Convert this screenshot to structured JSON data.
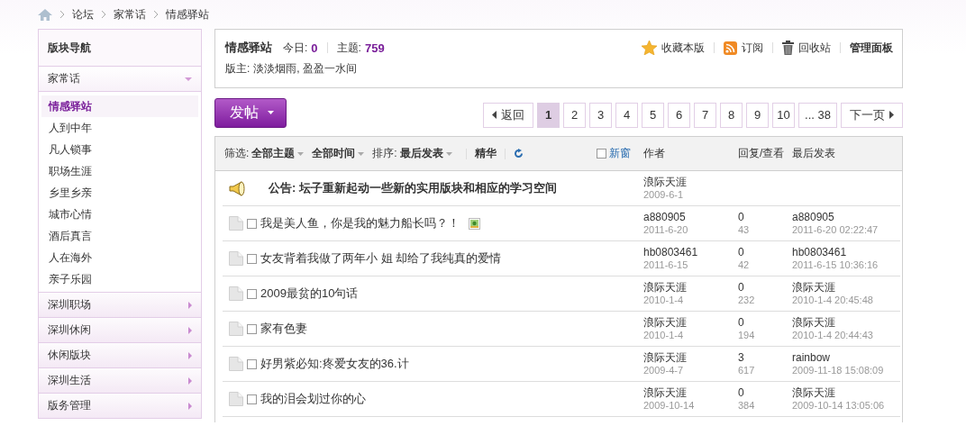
{
  "breadcrumb": [
    "论坛",
    "家常话",
    "情感驿站"
  ],
  "sidebar": {
    "title": "版块导航",
    "groups": [
      {
        "label": "家常话",
        "expanded": true,
        "children": [
          {
            "label": "情感驿站",
            "selected": true
          },
          {
            "label": "人到中年",
            "selected": false
          },
          {
            "label": "凡人锁事",
            "selected": false
          },
          {
            "label": "职场生涯",
            "selected": false
          },
          {
            "label": "乡里乡亲",
            "selected": false
          },
          {
            "label": "城市心情",
            "selected": false
          },
          {
            "label": "酒后真言",
            "selected": false
          },
          {
            "label": "人在海外",
            "selected": false
          },
          {
            "label": "亲子乐园",
            "selected": false
          }
        ]
      },
      {
        "label": "深圳职场",
        "expanded": false
      },
      {
        "label": "深圳休闲",
        "expanded": false
      },
      {
        "label": "休闲版块",
        "expanded": false
      },
      {
        "label": "深圳生活",
        "expanded": false
      },
      {
        "label": "版务管理",
        "expanded": false
      }
    ]
  },
  "forum": {
    "name": "情感驿站",
    "today_label": "今日:",
    "today": "0",
    "topics_label": "主题:",
    "topics": "759",
    "moderators_label": "版主:",
    "moderators": "淡淡烟雨, 盈盈一水间",
    "actions": [
      {
        "kind": "star",
        "label": "收藏本版"
      },
      {
        "kind": "rss",
        "label": "订阅"
      },
      {
        "kind": "trash",
        "label": "回收站"
      },
      {
        "kind": "admin",
        "label": "管理面板"
      }
    ]
  },
  "post_button": "发帖",
  "pagination": {
    "prev": "返回",
    "pages": [
      {
        "label": "1",
        "selected": true
      },
      {
        "label": "2",
        "selected": false
      },
      {
        "label": "3",
        "selected": false
      },
      {
        "label": "4",
        "selected": false
      },
      {
        "label": "5",
        "selected": false
      },
      {
        "label": "6",
        "selected": false
      },
      {
        "label": "7",
        "selected": false
      },
      {
        "label": "8",
        "selected": false
      },
      {
        "label": "9",
        "selected": false
      },
      {
        "label": "10",
        "selected": false
      },
      {
        "label": "... 38",
        "selected": false
      }
    ],
    "next": "下一页"
  },
  "filters": {
    "filter_label": "筛选:",
    "topic": "全部主题",
    "time": "全部时间",
    "sort_label": "排序:",
    "sort": "最后发表",
    "digest": "精华",
    "new_window": {
      "label": "新窗",
      "checked": false
    }
  },
  "columns": {
    "author": "作者",
    "stats": "回复/查看",
    "last": "最后发表"
  },
  "rows": [
    {
      "kind": "announcement",
      "title": "公告: 坛子重新起动一些新的实用版块和相应的学习空间",
      "author": "浪际天涯",
      "date": "2009-6-1"
    },
    {
      "kind": "thread",
      "checked": false,
      "title": "我是美人鱼，你是我的魅力船长吗？！",
      "has_image": true,
      "author": "a880905",
      "date": "2011-6-20",
      "replies": "0",
      "views": "43",
      "last_user": "a880905",
      "last_time": "2011-6-20 02:22:47"
    },
    {
      "kind": "thread",
      "checked": false,
      "title": "女友背着我做了两年小 姐 却给了我纯真的爱情",
      "has_image": false,
      "author": "hb0803461",
      "date": "2011-6-15",
      "replies": "0",
      "views": "42",
      "last_user": "hb0803461",
      "last_time": "2011-6-15 10:36:16"
    },
    {
      "kind": "thread",
      "checked": false,
      "title": "2009最贫的10句话",
      "has_image": false,
      "author": "浪际天涯",
      "date": "2010-1-4",
      "replies": "0",
      "views": "232",
      "last_user": "浪际天涯",
      "last_time": "2010-1-4 20:45:48"
    },
    {
      "kind": "thread",
      "checked": false,
      "title": "家有色妻",
      "has_image": false,
      "author": "浪际天涯",
      "date": "2010-1-4",
      "replies": "0",
      "views": "194",
      "last_user": "浪际天涯",
      "last_time": "2010-1-4 20:44:43"
    },
    {
      "kind": "thread",
      "checked": false,
      "title": "好男紫必知:疼爱女友的36.计",
      "has_image": false,
      "author": "浪际天涯",
      "date": "2009-4-7",
      "replies": "3",
      "views": "617",
      "last_user": "rainbow",
      "last_time": "2009-11-18 15:08:09"
    },
    {
      "kind": "thread",
      "checked": false,
      "title": "我的泪会划过你的心",
      "has_image": false,
      "author": "浪际天涯",
      "date": "2009-10-14",
      "replies": "0",
      "views": "384",
      "last_user": "浪际天涯",
      "last_time": "2009-10-14 13:05:06"
    }
  ]
}
